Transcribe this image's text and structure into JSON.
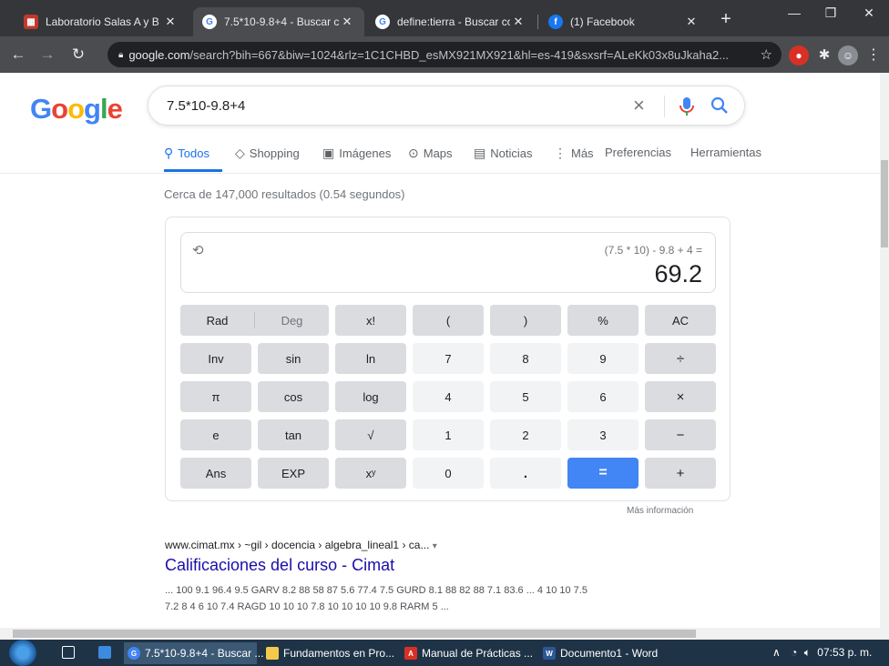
{
  "browser": {
    "tabs": [
      {
        "title": "Laboratorio Salas A y B",
        "favicon": "lab-favicon"
      },
      {
        "title": "7.5*10-9.8+4 - Buscar co",
        "favicon": "google-favicon",
        "active": true
      },
      {
        "title": "define:tierra - Buscar con",
        "favicon": "google-favicon"
      },
      {
        "title": "(1) Facebook",
        "favicon": "facebook-favicon"
      }
    ],
    "address": {
      "domain": "google.com",
      "path": "/search?bih=667&biw=1024&rlz=1C1CHBD_esMX921MX921&hl=es-419&sxsrf=ALeKk03x8uJkaha2..."
    }
  },
  "google": {
    "logo": "Google",
    "query": "7.5*10-9.8+4",
    "nav": [
      {
        "label": "Todos",
        "icon": "search-icon"
      },
      {
        "label": "Shopping",
        "icon": "tag-icon"
      },
      {
        "label": "Imágenes",
        "icon": "image-icon"
      },
      {
        "label": "Maps",
        "icon": "pin-icon"
      },
      {
        "label": "Noticias",
        "icon": "news-icon"
      },
      {
        "label": "Más",
        "icon": "more-icon"
      },
      {
        "label": "Preferencias"
      },
      {
        "label": "Herramientas"
      }
    ],
    "stats": "Cerca de 147,000 resultados (0.54 segundos)"
  },
  "calculator": {
    "expression": "(7.5 * 10) - 9.8 + 4 =",
    "result": "69.2",
    "rad": "Rad",
    "deg": "Deg",
    "keys": [
      [
        "x!",
        "(",
        ")",
        "%",
        "AC"
      ],
      [
        "Inv",
        "sin",
        "ln",
        "7",
        "8",
        "9",
        "÷"
      ],
      [
        "π",
        "cos",
        "log",
        "4",
        "5",
        "6",
        "×"
      ],
      [
        "e",
        "tan",
        "√",
        "1",
        "2",
        "3",
        "−"
      ],
      [
        "Ans",
        "EXP",
        "xʸ",
        "0",
        ".",
        "=",
        "+"
      ]
    ],
    "more_info": "Más información"
  },
  "result": {
    "breadcrumb": "www.cimat.mx › ~gil › docencia › algebra_lineal1 › ca...",
    "title": "Calificaciones del curso - Cimat",
    "snippet_line1": "... 100 9.1 96.4 9.5 GARV 8.2 88 58 87 5.6 77.4 7.5 GURD 8.1 88 82 88 7.1 83.6 ... 4 10 10 7.5",
    "snippet_line2": "7.2 8 4 6 10 7.4 RAGD 10 10 10 7.8 10 10 10 10 9.8 RARM 5 ..."
  },
  "taskbar": {
    "items": [
      {
        "label": "7.5*10-9.8+4 - Buscar ...",
        "icon": "chrome-icon",
        "color": "#4285f4"
      },
      {
        "label": "Fundamentos en Pro...",
        "icon": "folder-icon",
        "color": "#f2c94c"
      },
      {
        "label": "Manual de Prácticas ...",
        "icon": "pdf-icon",
        "color": "#d93025"
      },
      {
        "label": "Documento1 - Word",
        "icon": "word-icon",
        "color": "#2b5797"
      }
    ],
    "time": "07:53 p. m."
  }
}
